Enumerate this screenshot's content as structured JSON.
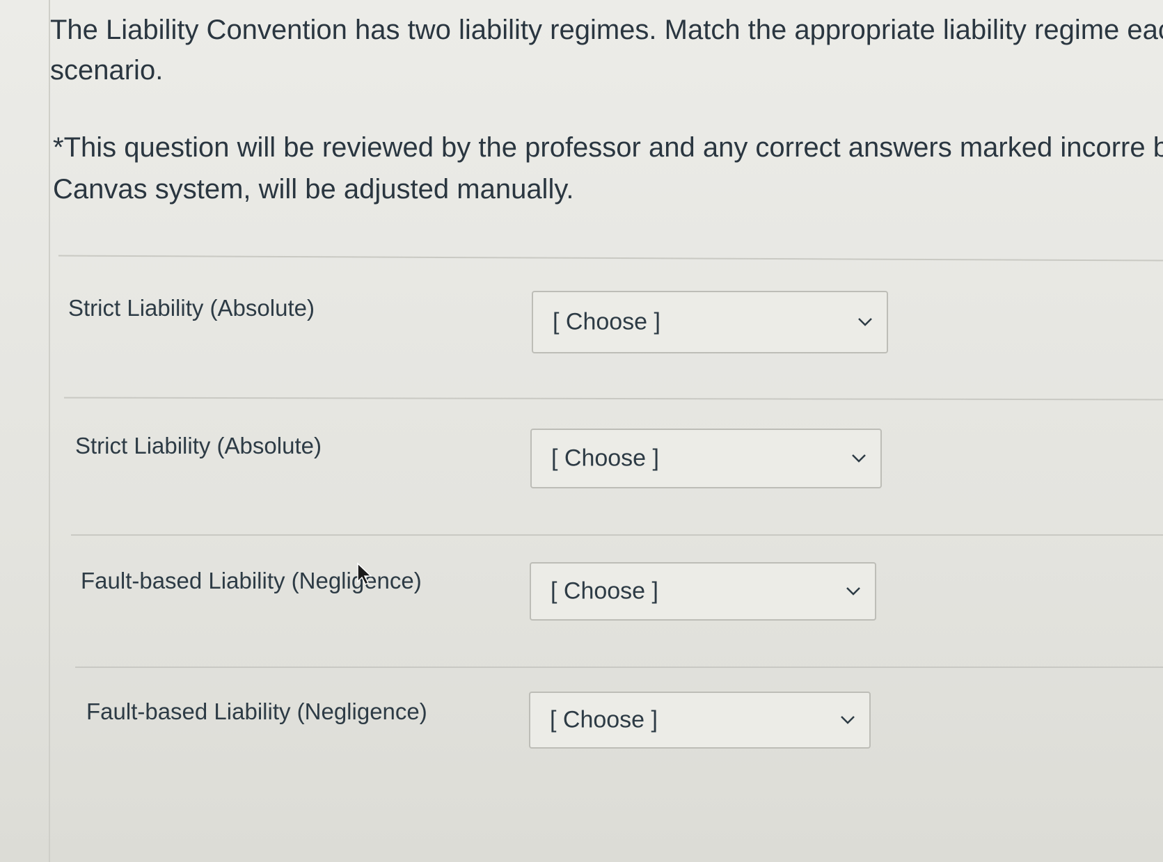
{
  "question": {
    "text": "The Liability Convention has two liability regimes. Match the appropriate liability regime each scenario.",
    "note": "*This question will be reviewed by the professor and any correct answers marked incorre by Canvas system, will be adjusted manually."
  },
  "matches": [
    {
      "label": "Strict Liability (Absolute)",
      "selected": "[ Choose ]"
    },
    {
      "label": "Strict Liability (Absolute)",
      "selected": "[ Choose ]"
    },
    {
      "label": "Fault-based Liability (Negligence)",
      "selected": "[ Choose ]"
    },
    {
      "label": "Fault-based Liability (Negligence)",
      "selected": "[ Choose ]"
    }
  ],
  "icons": {
    "dropdown": "chevron-down-icon",
    "pointer": "mouse-cursor-icon"
  }
}
